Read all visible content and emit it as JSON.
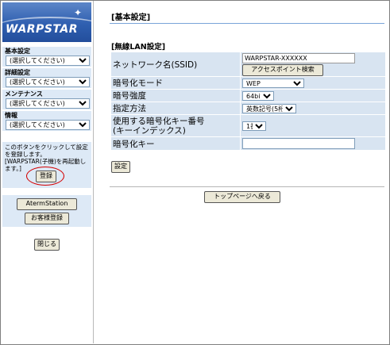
{
  "logo": {
    "text": "WARPSTAR"
  },
  "sidebar": {
    "menus": [
      {
        "label": "基本設定",
        "selected": "(選択してください)"
      },
      {
        "label": "詳細設定",
        "selected": "(選択してください)"
      },
      {
        "label": "メンテナンス",
        "selected": "(選択してください)"
      },
      {
        "label": "情報",
        "selected": "(選択してください)"
      }
    ],
    "notice_text": "このボタンをクリックして設定を登録します。[WARPSTAR(子機)を再起動します。]",
    "register_label": "登録",
    "aterm_station_label": "AtermStation",
    "customer_register_label": "お客様登録",
    "close_label": "閉じる"
  },
  "main": {
    "page_title": "[基本設定]",
    "section_title": "[無線LAN設定]",
    "rows": {
      "ssid": {
        "label": "ネットワーク名(SSID)",
        "value": "WARPSTAR-XXXXXX",
        "button": "アクセスポイント検索"
      },
      "encryption_mode": {
        "label": "暗号化モード",
        "value": "WEP"
      },
      "encryption_strength": {
        "label": "暗号強度",
        "value": "64bit"
      },
      "method": {
        "label": "指定方法",
        "value": "英数記号(5桁)"
      },
      "key_number": {
        "label": "使用する暗号化キー番号\n(キーインデックス)",
        "value": "1番"
      },
      "encryption_key": {
        "label": "暗号化キー",
        "value": ""
      }
    },
    "set_label": "設定",
    "top_page_label": "トップページへ戻る"
  }
}
